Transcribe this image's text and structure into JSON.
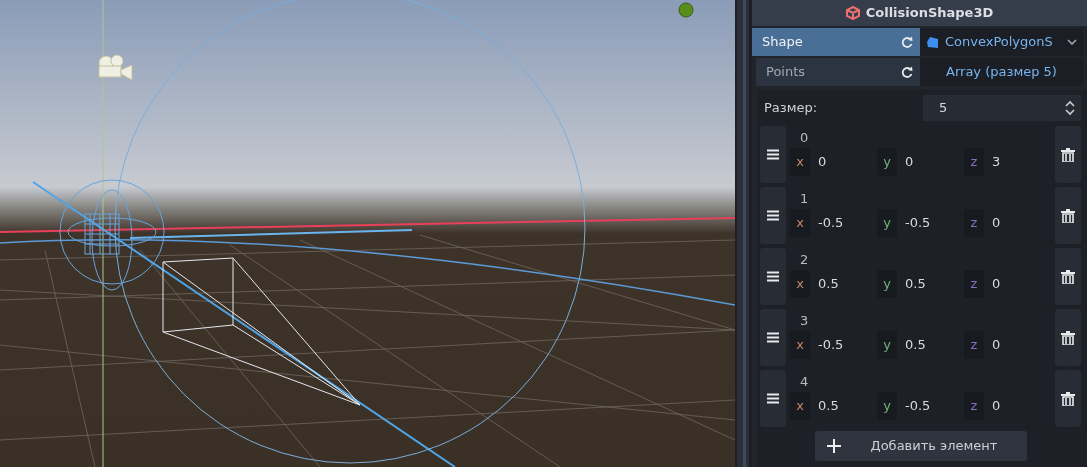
{
  "node_title": "CollisionShape3D",
  "properties": [
    {
      "label": "Shape",
      "value": "ConvexPolygonS",
      "kind": "resource",
      "selected": true
    },
    {
      "label": "Points",
      "value": "Array (размер 5)",
      "kind": "array",
      "selected": false
    }
  ],
  "size": {
    "label": "Размер:",
    "value": "5"
  },
  "points": [
    {
      "index": "0",
      "fields": [
        {
          "axis": "x",
          "value": "0"
        },
        {
          "axis": "y",
          "value": "0"
        },
        {
          "axis": "z",
          "value": "3"
        }
      ]
    },
    {
      "index": "1",
      "fields": [
        {
          "axis": "x",
          "value": "-0.5"
        },
        {
          "axis": "y",
          "value": "-0.5"
        },
        {
          "axis": "z",
          "value": "0"
        }
      ]
    },
    {
      "index": "2",
      "fields": [
        {
          "axis": "x",
          "value": "0.5"
        },
        {
          "axis": "y",
          "value": "0.5"
        },
        {
          "axis": "z",
          "value": "0"
        }
      ]
    },
    {
      "index": "3",
      "fields": [
        {
          "axis": "x",
          "value": "-0.5"
        },
        {
          "axis": "y",
          "value": "0.5"
        },
        {
          "axis": "z",
          "value": "0"
        }
      ]
    },
    {
      "index": "4",
      "fields": [
        {
          "axis": "x",
          "value": "0.5"
        },
        {
          "axis": "y",
          "value": "-0.5"
        },
        {
          "axis": "z",
          "value": "0"
        }
      ]
    }
  ],
  "add_button": "Добавить элемент"
}
